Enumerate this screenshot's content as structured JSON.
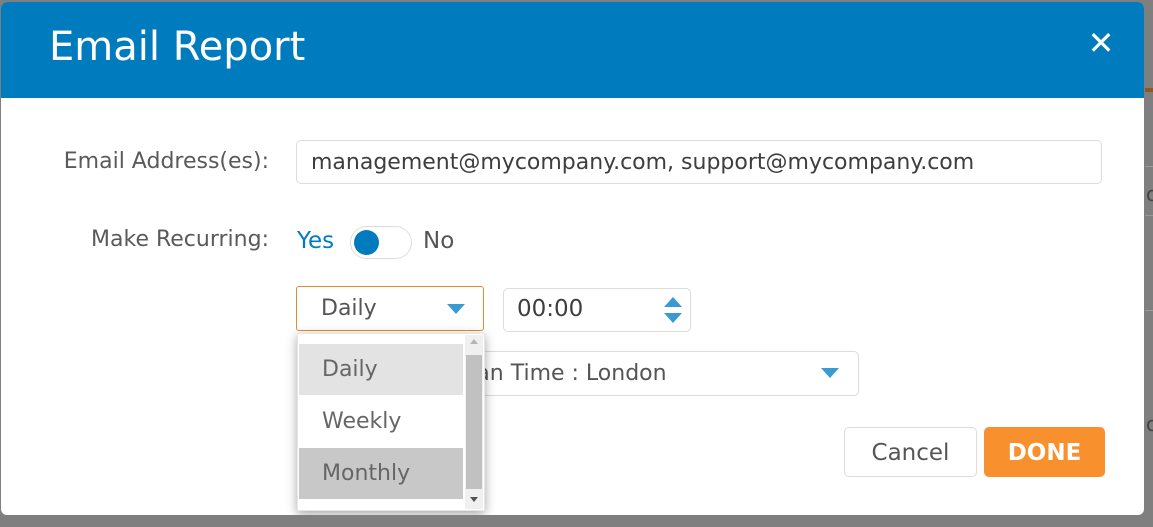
{
  "dialog": {
    "title": "Email Report",
    "close_icon": "close-icon",
    "colors": {
      "header": "#007bbd",
      "accent": "#007bbd",
      "primary_button": "#f7902d",
      "focus_border": "#e68a2e"
    }
  },
  "form": {
    "email_label": "Email Address(es):",
    "email_value": "management@mycompany.com, support@mycompany.com",
    "recurring_label": "Make Recurring:",
    "recurring_yes": "Yes",
    "recurring_no": "No",
    "recurring_on": true,
    "frequency": {
      "selected": "Daily",
      "options": [
        "Daily",
        "Weekly",
        "Monthly"
      ],
      "hovered": "Daily",
      "highlighted": "Monthly"
    },
    "time_value": "00:00",
    "timezone_value": "Greenwich Mean Time : London"
  },
  "footer": {
    "cancel_label": "Cancel",
    "done_label": "DONE"
  },
  "background": {
    "partial_text": [
      "o",
      "o"
    ]
  }
}
